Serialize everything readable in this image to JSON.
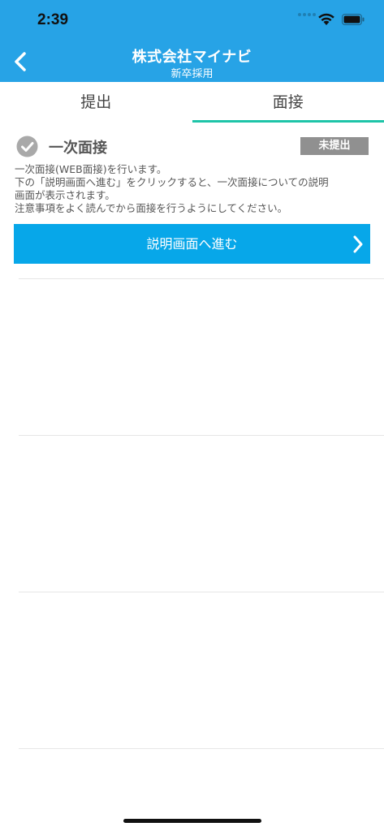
{
  "status_bar": {
    "time": "2:39"
  },
  "header": {
    "title": "株式会社マイナビ",
    "subtitle": "新卒採用"
  },
  "tabs": [
    {
      "label": "提出",
      "active": false
    },
    {
      "label": "面接",
      "active": true
    }
  ],
  "interview": {
    "title": "一次面接",
    "status": "未提出",
    "description_lines": [
      "一次面接(WEB面接)を行います。",
      "下の「説明画面へ進む」をクリックすると、一次面接についての説明",
      "画面が表示されます。",
      "注意事項をよく読んでから面接を行うようにしてください。"
    ],
    "button_label": "説明画面へ進む"
  },
  "colors": {
    "header_bg": "#27a3e6",
    "button_bg": "#07a7e9",
    "active_tab_underline": "#1ec4a8",
    "badge_bg": "#909090"
  }
}
